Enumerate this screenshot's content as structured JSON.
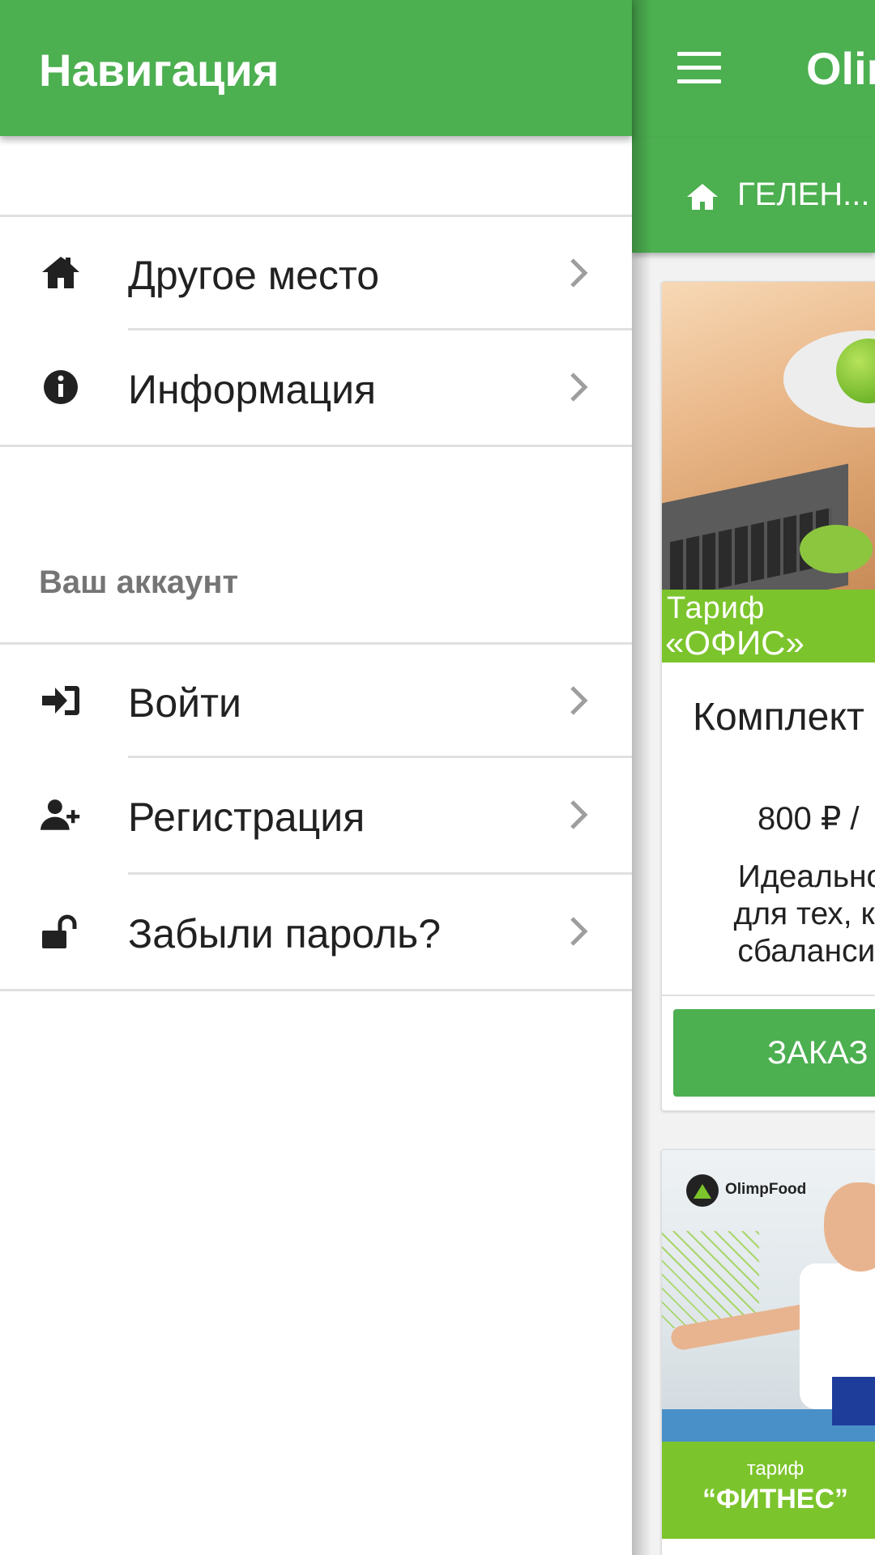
{
  "drawer": {
    "title": "Навигация",
    "items": [
      {
        "label": "Другое место",
        "icon": "home-icon"
      },
      {
        "label": "Информация",
        "icon": "info-icon"
      }
    ],
    "account_section": {
      "label": "Ваш аккаунт",
      "items": [
        {
          "label": "Войти",
          "icon": "sign-in-icon"
        },
        {
          "label": "Регистрация",
          "icon": "user-plus-icon"
        },
        {
          "label": "Забыли пароль?",
          "icon": "unlock-icon"
        }
      ]
    }
  },
  "app": {
    "title": "Olim",
    "location": "ГЕЛЕН...",
    "cards": [
      {
        "banner_small": "Тариф",
        "banner_big": "«ОФИС»",
        "title": "Комплект",
        "price": "800 ₽ /",
        "description": [
          "Идеально п",
          "для тех, ком",
          "сбалансиро"
        ],
        "button": "ЗАКАЗ"
      },
      {
        "logo": "OlimpFood",
        "banner_small": "тариф",
        "banner_big": "“ФИТНЕС”"
      }
    ]
  },
  "colors": {
    "primary": "#4caf50",
    "banner_green": "#7cc42c",
    "text": "#212121",
    "muted": "#757575",
    "divider": "#e0e0e0"
  }
}
